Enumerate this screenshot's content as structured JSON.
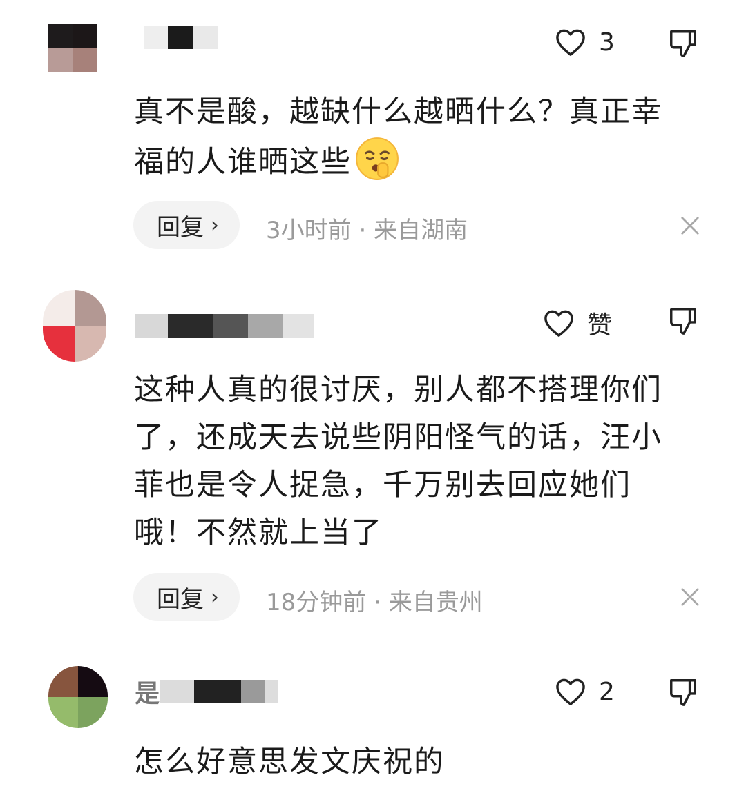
{
  "comments": [
    {
      "like_count": "3",
      "text_lines": [
        "真不是酸，越缺什么越晒什么？真正幸",
        "福的人谁晒这些"
      ],
      "reply_label": "回复",
      "reply_chevron": "›",
      "time": "3小时前",
      "separator": "·",
      "location": "来自湖南",
      "emoji": "shushing-face",
      "avatar_colors": [
        "#1e1b1c",
        "#1c1718",
        "#b89b97",
        "#a7817a"
      ]
    },
    {
      "like_count": "赞",
      "text_lines": [
        "这种人真的很讨厌，别人都不搭理你们",
        "了，还成天去说些阴阳怪气的话，汪小",
        "菲也是令人捉急，千万别去回应她们",
        "哦！不然就上当了"
      ],
      "reply_label": "回复",
      "reply_chevron": "›",
      "time": "18分钟前",
      "separator": "·",
      "location": "来自贵州",
      "avatar_colors": [
        "#f4ece9",
        "#b39893",
        "#e6303d",
        "#d7b8b0"
      ]
    },
    {
      "like_count": "2",
      "text_lines": [
        "怎么好意思发文庆祝的"
      ],
      "name_visible_char": "是",
      "avatar_colors": [
        "#87553e",
        "#150b12",
        "#95bb6b",
        "#7ca35e"
      ]
    }
  ],
  "icons": {
    "like": "heart-outline-icon",
    "dislike": "thumbs-down-icon",
    "close": "close-icon"
  }
}
